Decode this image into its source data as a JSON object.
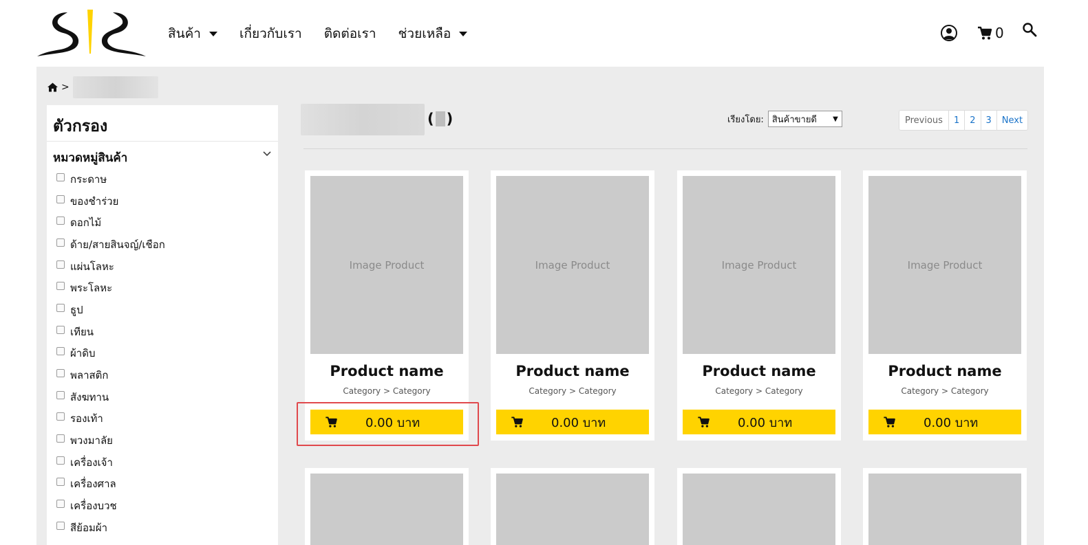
{
  "header": {
    "logo": "SR",
    "nav": [
      {
        "label": "สินค้า",
        "has_dropdown": true
      },
      {
        "label": "เกี่ยวกับเรา",
        "has_dropdown": false
      },
      {
        "label": "ติดต่อเรา",
        "has_dropdown": false
      },
      {
        "label": "ช่วยเหลือ",
        "has_dropdown": true
      }
    ],
    "cart_count": "0",
    "icons": [
      "user-icon",
      "cart-icon",
      "search-icon"
    ]
  },
  "breadcrumb": {
    "separator": ">"
  },
  "filter": {
    "title": "ตัวกรอง",
    "group_title": "หมวดหมู่สินค้า",
    "items": [
      "กระดาษ",
      "ของชำร่วย",
      "ดอกไม้",
      "ด้าย/สายสินจญ์/เชือก",
      "แผ่นโลหะ",
      "พระโลหะ",
      "ธูป",
      "เทียน",
      "ผ้าดิบ",
      "พลาสติก",
      "สังฆทาน",
      "รองเท้า",
      "พวงมาลัย",
      "เครื่องเจ้า",
      "เครื่องศาล",
      "เครื่องบวช",
      "สีย้อมผ้า"
    ]
  },
  "content": {
    "count_open": "(",
    "count_close": ")",
    "sort_label": "เรียงโดย:",
    "sort_value": "สินค้าขายดี",
    "sort_arrow": "▼",
    "pagination": [
      "Previous",
      "1",
      "2",
      "3",
      "Next"
    ]
  },
  "products": [
    {
      "image_label": "Image Product",
      "name": "Product name",
      "category": "Category > Category",
      "price": "0.00 บาท"
    },
    {
      "image_label": "Image Product",
      "name": "Product name",
      "category": "Category > Category",
      "price": "0.00 บาท"
    },
    {
      "image_label": "Image Product",
      "name": "Product name",
      "category": "Category > Category",
      "price": "0.00 บาท"
    },
    {
      "image_label": "Image Product",
      "name": "Product name",
      "category": "Category > Category",
      "price": "0.00 บาท"
    }
  ],
  "colors": {
    "accent": "#ffd300",
    "panel": "#ececec",
    "highlight": "#e0484c",
    "link": "#1a73c9"
  }
}
